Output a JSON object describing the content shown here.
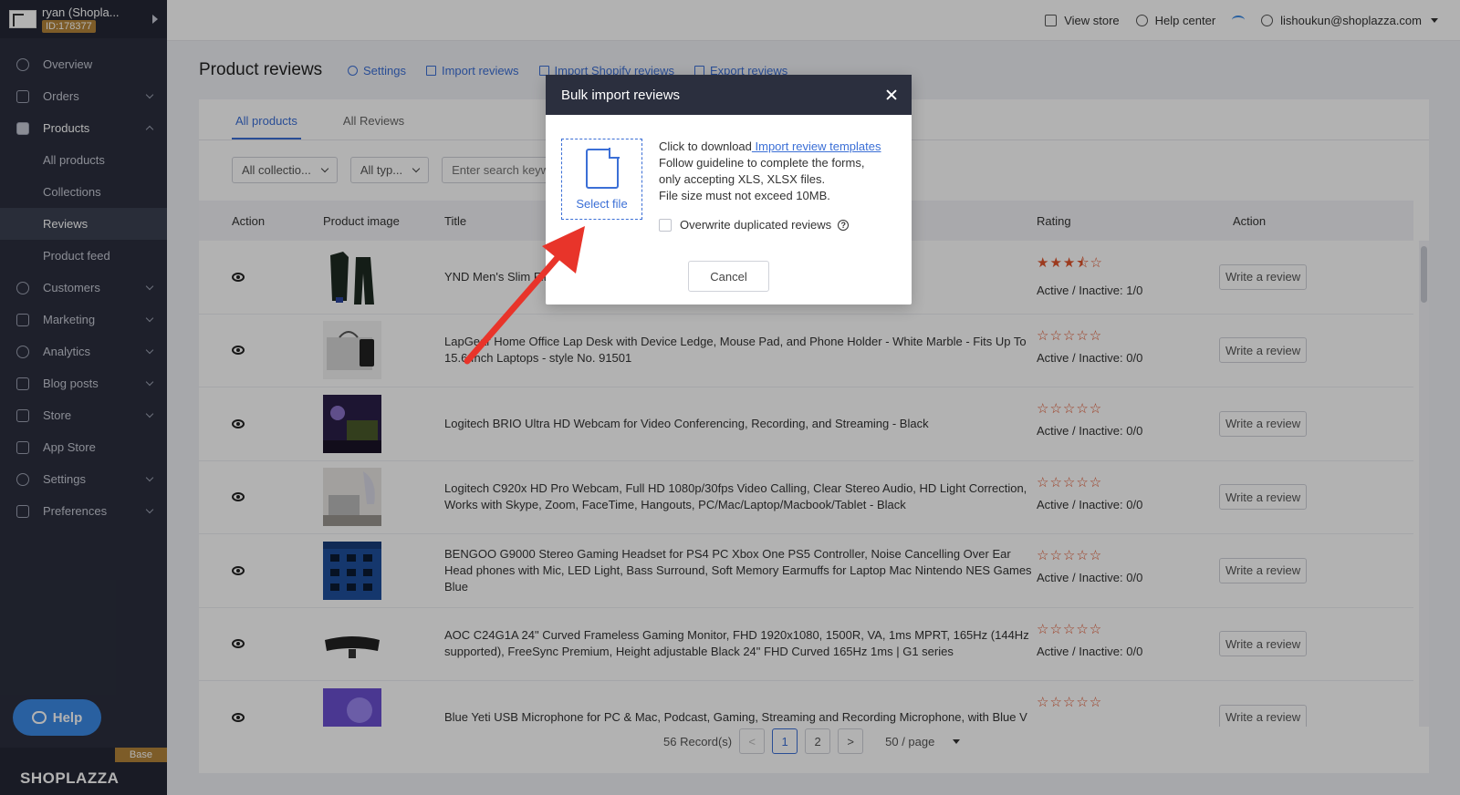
{
  "sidebar": {
    "store_name": "ryan (Shopla...",
    "store_id": "ID:178377",
    "items": [
      {
        "label": "Overview",
        "icon": "dashboard-icon"
      },
      {
        "label": "Orders",
        "icon": "orders-icon"
      },
      {
        "label": "Products",
        "icon": "box-icon"
      },
      {
        "label": "Customers",
        "icon": "users-icon"
      },
      {
        "label": "Marketing",
        "icon": "megaphone-icon"
      },
      {
        "label": "Analytics",
        "icon": "chart-icon"
      },
      {
        "label": "Blog posts",
        "icon": "document-icon"
      },
      {
        "label": "Store",
        "icon": "store-icon"
      },
      {
        "label": "App Store",
        "icon": "puzzle-icon"
      },
      {
        "label": "Settings",
        "icon": "gear-icon"
      },
      {
        "label": "Preferences",
        "icon": "monitor-icon"
      }
    ],
    "product_sub": [
      "All products",
      "Collections",
      "Reviews",
      "Product feed"
    ],
    "help": "Help",
    "base": "Base",
    "brand": "SHOPLAZZA"
  },
  "topbar": {
    "view_store": "View store",
    "help_center": "Help center",
    "user": "lishoukun@shoplazza.com"
  },
  "page": {
    "title": "Product reviews",
    "actions": [
      "Settings",
      "Import reviews",
      "Import Shopify reviews",
      "Export reviews"
    ]
  },
  "tabs": [
    "All products",
    "All Reviews"
  ],
  "filters": {
    "collection": "All collectio...",
    "type": "All typ...",
    "search_placeholder": "Enter search keywords"
  },
  "table": {
    "headers": [
      "Action",
      "Product image",
      "Title",
      "Rating",
      "Action"
    ],
    "rows": [
      {
        "title": "YND Men's Slim Fit Suits, Two-Piece Suit Blazer Jacket & Trousers - Deep Blue Large",
        "stars": "★★★⯪☆",
        "ai": "Active / Inactive: 1/0",
        "btn": "Write a review"
      },
      {
        "title": "LapGear Home Office Lap Desk with Device Ledge, Mouse Pad, and Phone Holder - White Marble - Fits Up To 15.6 Inch Laptops - style No. 91501",
        "stars": "☆☆☆☆☆",
        "ai": "Active / Inactive: 0/0",
        "btn": "Write a review"
      },
      {
        "title": "Logitech BRIO Ultra HD Webcam for Video Conferencing, Recording, and Streaming - Black",
        "stars": "☆☆☆☆☆",
        "ai": "Active / Inactive: 0/0",
        "btn": "Write a review"
      },
      {
        "title": "Logitech C920x HD Pro Webcam, Full HD 1080p/30fps Video Calling, Clear Stereo Audio, HD Light Correction, Works with Skype, Zoom, FaceTime, Hangouts, PC/Mac/Laptop/Macbook/Tablet - Black",
        "stars": "☆☆☆☆☆",
        "ai": "Active / Inactive: 0/0",
        "btn": "Write a review"
      },
      {
        "title": "BENGOO G9000 Stereo Gaming Headset for PS4 PC Xbox One PS5 Controller, Noise Cancelling Over Ear Head phones with Mic, LED Light, Bass Surround, Soft Memory Earmuffs for Laptop Mac Nintendo NES Games Blue",
        "stars": "☆☆☆☆☆",
        "ai": "Active / Inactive: 0/0",
        "btn": "Write a review"
      },
      {
        "title": "AOC C24G1A 24\" Curved Frameless Gaming Monitor, FHD 1920x1080, 1500R, VA, 1ms MPRT, 165Hz (144Hz supported), FreeSync Premium, Height adjustable Black 24\" FHD Curved 165Hz 1ms | G1 series",
        "stars": "☆☆☆☆☆",
        "ai": "Active / Inactive: 0/0",
        "btn": "Write a review"
      },
      {
        "title": "Blue Yeti USB Microphone for PC & Mac, Podcast, Gaming, Streaming and Recording Microphone, with Blue V",
        "stars": "☆☆☆☆☆",
        "ai": "",
        "btn": "Write a review"
      }
    ]
  },
  "pager": {
    "records": "56 Record(s)",
    "prev": "<",
    "pages": [
      "1",
      "2"
    ],
    "next": ">",
    "per_page": "50 / page"
  },
  "modal": {
    "title": "Bulk import reviews",
    "select_file": "Select file",
    "line1_prefix": "Click to download",
    "line1_link": " Import review templates",
    "line2": "Follow guideline to complete the forms,",
    "line3": "only accepting XLS, XLSX files.",
    "line4": "File size must not exceed 10MB.",
    "overwrite": "Overwrite duplicated reviews",
    "cancel": "Cancel"
  },
  "colors": {
    "accent": "#3b6fd6",
    "sidebar": "#2b2f3e",
    "star": "#e0532c",
    "arrow": "#e8342a"
  }
}
